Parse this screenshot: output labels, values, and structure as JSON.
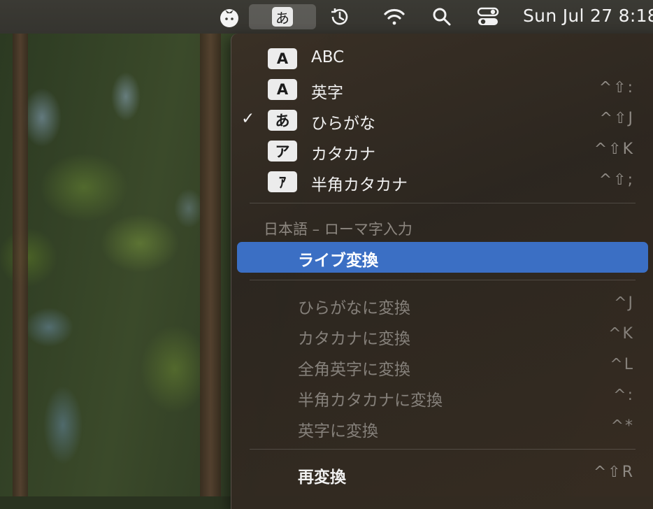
{
  "menubar": {
    "ime_glyph": "あ",
    "clock": "Sun Jul 27  8:18"
  },
  "input_sources": [
    {
      "badge": "A",
      "label": "ABC",
      "shortcut": "",
      "checked": false
    },
    {
      "badge": "A",
      "label": "英字",
      "shortcut": "^⇧:",
      "checked": false
    },
    {
      "badge": "あ",
      "label": "ひらがな",
      "shortcut": "^⇧J",
      "checked": true
    },
    {
      "badge": "ア",
      "label": "カタカナ",
      "shortcut": "^⇧K",
      "checked": false
    },
    {
      "badge": "ｱ",
      "label": "半角カタカナ",
      "shortcut": "^⇧;",
      "checked": false
    }
  ],
  "check_mark": "✓",
  "section_title": "日本語 – ローマ字入力",
  "live_conversion": {
    "label": "ライブ変換",
    "highlighted": true,
    "highlight_color": "#3b6fc4"
  },
  "convert_items": [
    {
      "label": "ひらがなに変換",
      "shortcut": "^J",
      "enabled": false
    },
    {
      "label": "カタカナに変換",
      "shortcut": "^K",
      "enabled": false
    },
    {
      "label": "全角英字に変換",
      "shortcut": "^L",
      "enabled": false
    },
    {
      "label": "半角カタカナに変換",
      "shortcut": "^:",
      "enabled": false
    },
    {
      "label": "英字に変換",
      "shortcut": "^*",
      "enabled": false
    }
  ],
  "reconvert": {
    "label": "再変換",
    "shortcut": "^⇧R",
    "enabled": true
  }
}
